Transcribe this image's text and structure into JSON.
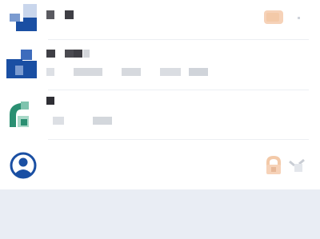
{
  "colors": {
    "brand_blue": "#1a4fa3",
    "brand_green": "#2a8f72",
    "pixel_gray": "#cfd3da",
    "pixel_dark": "#3f3f45",
    "badge_peach": "#f3c9a8",
    "background": "#e9edf4"
  },
  "rows": [
    {
      "name": "row-1",
      "icon": "app-logo-blue-icon",
      "trailing_icon": "badge-icon"
    },
    {
      "name": "row-2",
      "icon": "app-logo-blue-icon"
    },
    {
      "name": "row-3",
      "icon": "app-logo-green-icon"
    },
    {
      "name": "row-4",
      "icon": "user-circle-icon",
      "trailing_icon": "lock-icon"
    }
  ]
}
